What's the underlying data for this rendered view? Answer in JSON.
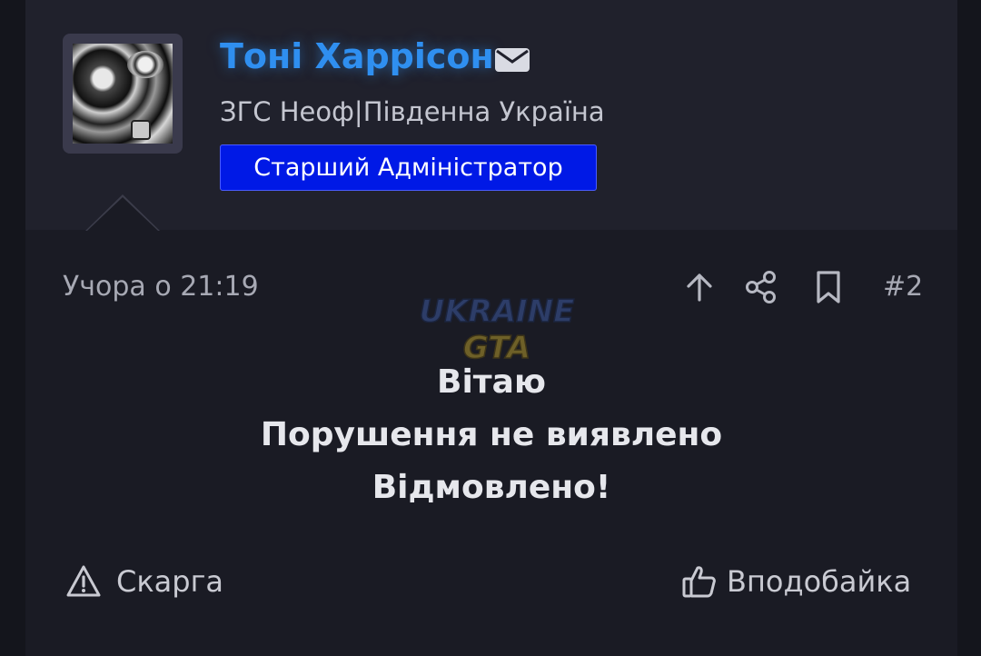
{
  "colors": {
    "background": "#14151c",
    "post_background": "#1a1b24",
    "header_background": "#20212c",
    "username": "#2f8ff0",
    "rank_badge": "#0019e6",
    "muted_text": "#a7a9b4",
    "message_text": "#e6e7ec"
  },
  "user": {
    "name": "Тоні Харрісон",
    "title": "ЗГС Неоф|Південна Україна",
    "rank": "Старший Адміністратор",
    "avatar": "avatar-photo",
    "mail_icon": "envelope-icon"
  },
  "post": {
    "timestamp": "Учора о 21:19",
    "number": "#2",
    "icons": [
      "arrow-up-icon",
      "share-icon",
      "bookmark-icon"
    ],
    "watermark": {
      "line1": "UKRAINE",
      "line2": "GTA"
    },
    "message": [
      "Вітаю",
      "Порушення не виявлено",
      "Відмовлено!"
    ]
  },
  "footer": {
    "report_label": "Скарга",
    "like_label": "Вподобайка"
  }
}
